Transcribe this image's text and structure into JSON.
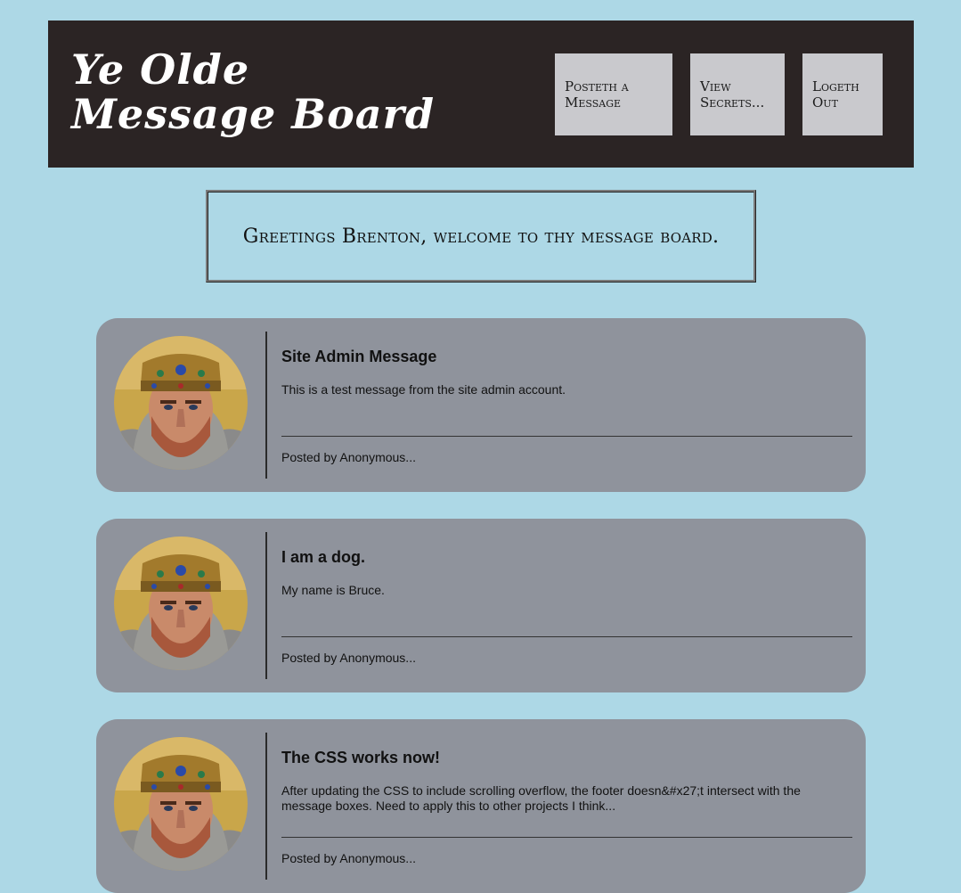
{
  "header": {
    "title": "Ye Olde Message Board",
    "nav": {
      "post_label": "Posteth a Message",
      "secrets_label": "View Secrets...",
      "logout_label": "Logeth Out"
    }
  },
  "welcome": {
    "text": "Greetings Brenton, welcome to thy message board."
  },
  "messages": [
    {
      "title": "Site Admin Message",
      "body": "This is a test message from the site admin account.",
      "footer": "Posted by Anonymous..."
    },
    {
      "title": "I am a dog.",
      "body": "My name is Bruce.",
      "footer": "Posted by Anonymous..."
    },
    {
      "title": "The CSS works now!",
      "body": "After updating the CSS to include scrolling overflow, the footer doesn&#x27;t intersect with the message boxes. Need to apply this to other projects I think...",
      "footer": "Posted by Anonymous..."
    }
  ],
  "colors": {
    "page_background": "#add8e6",
    "header_background": "#2b2424",
    "nav_button": "#c9c9cd",
    "card_background": "#8f939c"
  },
  "icons": {
    "avatar": "knight-portrait"
  }
}
